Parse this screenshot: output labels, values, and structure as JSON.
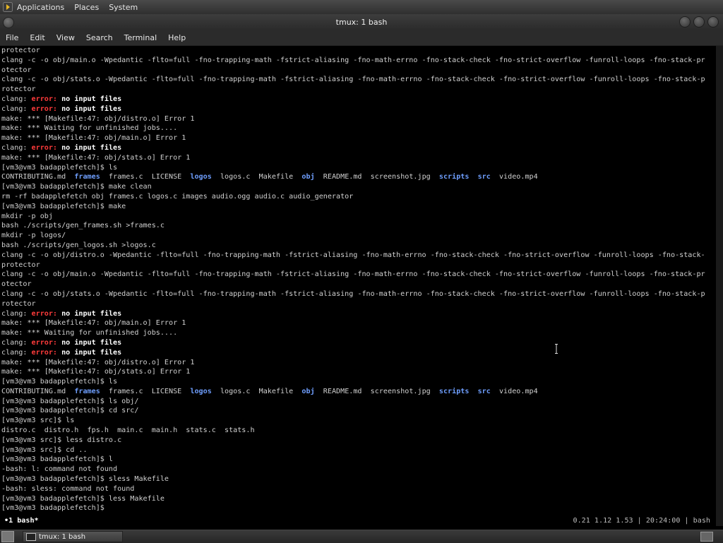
{
  "top_panel": {
    "menus": [
      "Applications",
      "Places",
      "System"
    ]
  },
  "window": {
    "title": "tmux: 1 bash",
    "menus": [
      "File",
      "Edit",
      "View",
      "Search",
      "Terminal",
      "Help"
    ]
  },
  "terminal": {
    "lines": [
      [
        {
          "t": "protector"
        }
      ],
      [
        {
          "t": "clang -c -o obj/main.o -Wpedantic -flto=full -fno-trapping-math -fstrict-aliasing -fno-math-errno -fno-stack-check -fno-strict-overflow -funroll-loops -fno-stack-pr"
        }
      ],
      [
        {
          "t": "otector"
        }
      ],
      [
        {
          "t": "clang -c -o obj/stats.o -Wpedantic -flto=full -fno-trapping-math -fstrict-aliasing -fno-math-errno -fno-stack-check -fno-strict-overflow -funroll-loops -fno-stack-p"
        }
      ],
      [
        {
          "t": "rotector"
        }
      ],
      [
        {
          "t": "clang: "
        },
        {
          "t": "error:",
          "c": "err"
        },
        {
          "t": " "
        },
        {
          "t": "no input files",
          "c": "bold"
        }
      ],
      [
        {
          "t": "clang: "
        },
        {
          "t": "error:",
          "c": "err"
        },
        {
          "t": " "
        },
        {
          "t": "no input files",
          "c": "bold"
        }
      ],
      [
        {
          "t": "make: *** [Makefile:47: obj/distro.o] Error 1"
        }
      ],
      [
        {
          "t": "make: *** Waiting for unfinished jobs...."
        }
      ],
      [
        {
          "t": "make: *** [Makefile:47: obj/main.o] Error 1"
        }
      ],
      [
        {
          "t": "clang: "
        },
        {
          "t": "error:",
          "c": "err"
        },
        {
          "t": " "
        },
        {
          "t": "no input files",
          "c": "bold"
        }
      ],
      [
        {
          "t": "make: *** [Makefile:47: obj/stats.o] Error 1"
        }
      ],
      [
        {
          "t": "[vm3@vm3 badapplefetch]$ ls"
        }
      ],
      [
        {
          "t": "CONTRIBUTING.md  "
        },
        {
          "t": "frames",
          "c": "dir"
        },
        {
          "t": "  frames.c  LICENSE  "
        },
        {
          "t": "logos",
          "c": "dir"
        },
        {
          "t": "  logos.c  Makefile  "
        },
        {
          "t": "obj",
          "c": "dir"
        },
        {
          "t": "  README.md  screenshot.jpg  "
        },
        {
          "t": "scripts",
          "c": "dir"
        },
        {
          "t": "  "
        },
        {
          "t": "src",
          "c": "dir"
        },
        {
          "t": "  video.mp4"
        }
      ],
      [
        {
          "t": "[vm3@vm3 badapplefetch]$ make clean"
        }
      ],
      [
        {
          "t": "rm -rf badapplefetch obj frames.c logos.c images audio.ogg audio.c audio_generator"
        }
      ],
      [
        {
          "t": "[vm3@vm3 badapplefetch]$ make"
        }
      ],
      [
        {
          "t": "mkdir -p obj"
        }
      ],
      [
        {
          "t": "bash ./scripts/gen_frames.sh >frames.c"
        }
      ],
      [
        {
          "t": "mkdir -p logos/"
        }
      ],
      [
        {
          "t": "bash ./scripts/gen_logos.sh >logos.c"
        }
      ],
      [
        {
          "t": "clang -c -o obj/distro.o -Wpedantic -flto=full -fno-trapping-math -fstrict-aliasing -fno-math-errno -fno-stack-check -fno-strict-overflow -funroll-loops -fno-stack-"
        }
      ],
      [
        {
          "t": "protector"
        }
      ],
      [
        {
          "t": "clang -c -o obj/main.o -Wpedantic -flto=full -fno-trapping-math -fstrict-aliasing -fno-math-errno -fno-stack-check -fno-strict-overflow -funroll-loops -fno-stack-pr"
        }
      ],
      [
        {
          "t": "otector"
        }
      ],
      [
        {
          "t": "clang -c -o obj/stats.o -Wpedantic -flto=full -fno-trapping-math -fstrict-aliasing -fno-math-errno -fno-stack-check -fno-strict-overflow -funroll-loops -fno-stack-p"
        }
      ],
      [
        {
          "t": "rotector"
        }
      ],
      [
        {
          "t": "clang: "
        },
        {
          "t": "error:",
          "c": "err"
        },
        {
          "t": " "
        },
        {
          "t": "no input files",
          "c": "bold"
        }
      ],
      [
        {
          "t": "make: *** [Makefile:47: obj/main.o] Error 1"
        }
      ],
      [
        {
          "t": "make: *** Waiting for unfinished jobs...."
        }
      ],
      [
        {
          "t": "clang: "
        },
        {
          "t": "error:",
          "c": "err"
        },
        {
          "t": " "
        },
        {
          "t": "no input files",
          "c": "bold"
        }
      ],
      [
        {
          "t": "clang: "
        },
        {
          "t": "error:",
          "c": "err"
        },
        {
          "t": " "
        },
        {
          "t": "no input files",
          "c": "bold"
        }
      ],
      [
        {
          "t": "make: *** [Makefile:47: obj/distro.o] Error 1"
        }
      ],
      [
        {
          "t": "make: *** [Makefile:47: obj/stats.o] Error 1"
        }
      ],
      [
        {
          "t": "[vm3@vm3 badapplefetch]$ ls"
        }
      ],
      [
        {
          "t": "CONTRIBUTING.md  "
        },
        {
          "t": "frames",
          "c": "dir"
        },
        {
          "t": "  frames.c  LICENSE  "
        },
        {
          "t": "logos",
          "c": "dir"
        },
        {
          "t": "  logos.c  Makefile  "
        },
        {
          "t": "obj",
          "c": "dir"
        },
        {
          "t": "  README.md  screenshot.jpg  "
        },
        {
          "t": "scripts",
          "c": "dir"
        },
        {
          "t": "  "
        },
        {
          "t": "src",
          "c": "dir"
        },
        {
          "t": "  video.mp4"
        }
      ],
      [
        {
          "t": "[vm3@vm3 badapplefetch]$ ls obj/"
        }
      ],
      [
        {
          "t": "[vm3@vm3 badapplefetch]$ cd src/"
        }
      ],
      [
        {
          "t": "[vm3@vm3 src]$ ls"
        }
      ],
      [
        {
          "t": "distro.c  distro.h  fps.h  main.c  main.h  stats.c  stats.h"
        }
      ],
      [
        {
          "t": "[vm3@vm3 src]$ less distro.c"
        }
      ],
      [
        {
          "t": "[vm3@vm3 src]$ cd .."
        }
      ],
      [
        {
          "t": "[vm3@vm3 badapplefetch]$ l"
        }
      ],
      [
        {
          "t": "-bash: l: command not found"
        }
      ],
      [
        {
          "t": "[vm3@vm3 badapplefetch]$ sless Makefile"
        }
      ],
      [
        {
          "t": "-bash: sless: command not found"
        }
      ],
      [
        {
          "t": "[vm3@vm3 badapplefetch]$ less Makefile"
        }
      ],
      [
        {
          "t": "[vm3@vm3 badapplefetch]$"
        }
      ]
    ]
  },
  "tmux_status": {
    "left": "•1 bash*",
    "right": "0.21 1.12 1.53 | 20:24:00 | bash"
  },
  "taskbar": {
    "task_label": "tmux: 1 bash"
  },
  "colors": {
    "error": "#ff3b3b",
    "directory": "#6f9fff",
    "terminal_bg": "#000000",
    "terminal_fg": "#d0d0d0"
  }
}
